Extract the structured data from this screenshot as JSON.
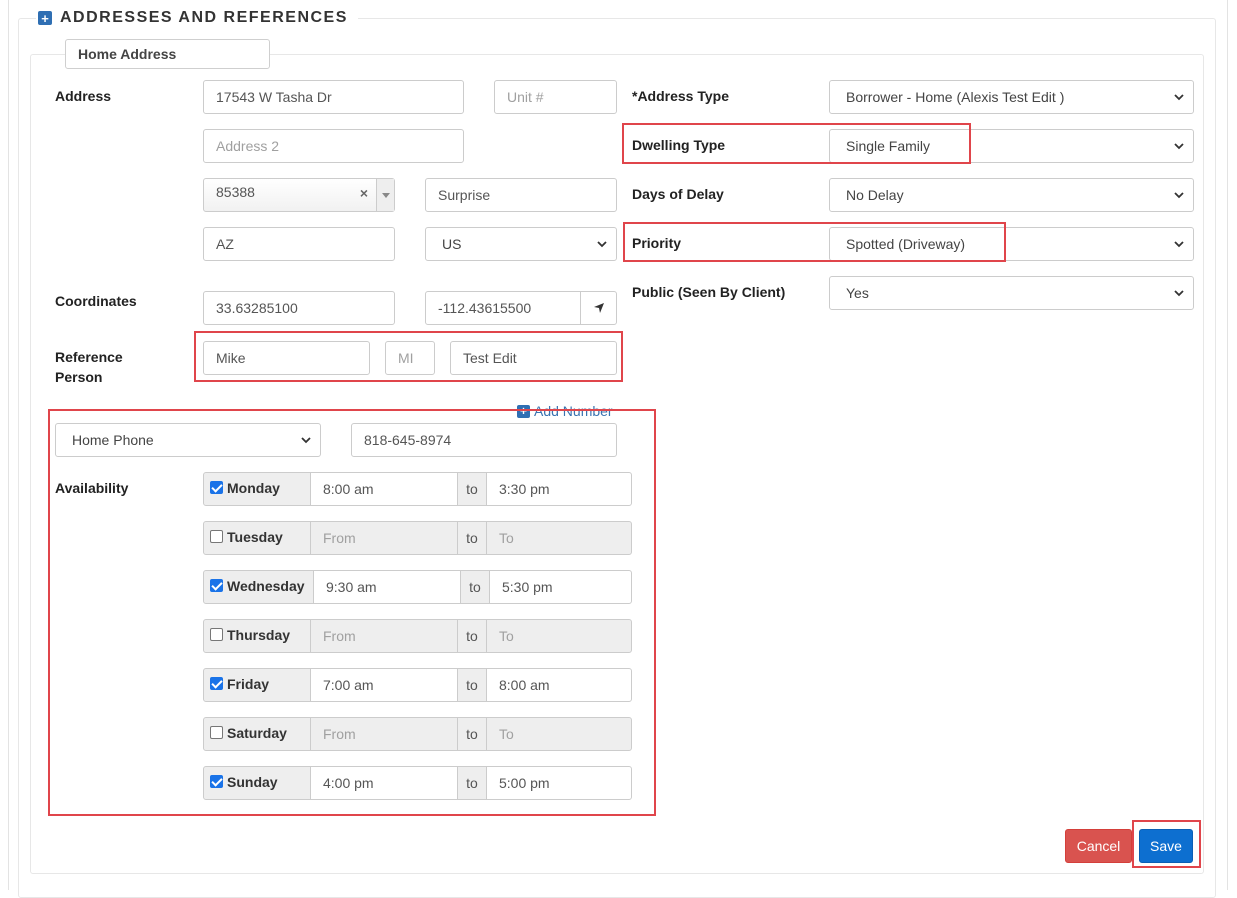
{
  "section": {
    "title": "ADDRESSES AND REFERENCES"
  },
  "tab": {
    "label": "Home Address"
  },
  "labels": {
    "address": "Address",
    "coordinates": "Coordinates",
    "reference_person": "Reference Person",
    "availability": "Availability",
    "address_type": "*Address Type",
    "dwelling_type": "Dwelling Type",
    "days_of_delay": "Days of Delay",
    "priority": "Priority",
    "public": "Public (Seen By Client)"
  },
  "address": {
    "line1": "17543 W Tasha Dr",
    "unit_placeholder": "Unit #",
    "line2_placeholder": "Address 2",
    "zip": "85388",
    "clear_symbol": "×",
    "city": "Surprise",
    "state": "AZ",
    "country": "US"
  },
  "coordinates": {
    "lat": "33.63285100",
    "lng": "-112.43615500"
  },
  "reference": {
    "first": "Mike",
    "middle_placeholder": "MI",
    "last": "Test Edit"
  },
  "phone": {
    "add_label": "Add Number",
    "type": "Home Phone",
    "number": "818-645-8974"
  },
  "availability": {
    "to_label": "to",
    "days": [
      {
        "name": "Monday",
        "checked": true,
        "from": "8:00 am",
        "to": "3:30 pm"
      },
      {
        "name": "Tuesday",
        "checked": false,
        "from": "From",
        "to": "To"
      },
      {
        "name": "Wednesday",
        "checked": true,
        "from": "9:30 am",
        "to": "5:30 pm"
      },
      {
        "name": "Thursday",
        "checked": false,
        "from": "From",
        "to": "To"
      },
      {
        "name": "Friday",
        "checked": true,
        "from": "7:00 am",
        "to": "8:00 am"
      },
      {
        "name": "Saturday",
        "checked": false,
        "from": "From",
        "to": "To"
      },
      {
        "name": "Sunday",
        "checked": true,
        "from": "4:00 pm",
        "to": "5:00 pm"
      }
    ]
  },
  "right": {
    "address_type": "Borrower - Home (Alexis Test Edit )",
    "dwelling_type": "Single Family",
    "days_of_delay": "No Delay",
    "priority": "Spotted (Driveway)",
    "public": "Yes"
  },
  "buttons": {
    "cancel": "Cancel",
    "save": "Save"
  },
  "colors": {
    "accent": "#0d6fd0",
    "danger": "#d9534f",
    "highlight": "#e0454b"
  }
}
